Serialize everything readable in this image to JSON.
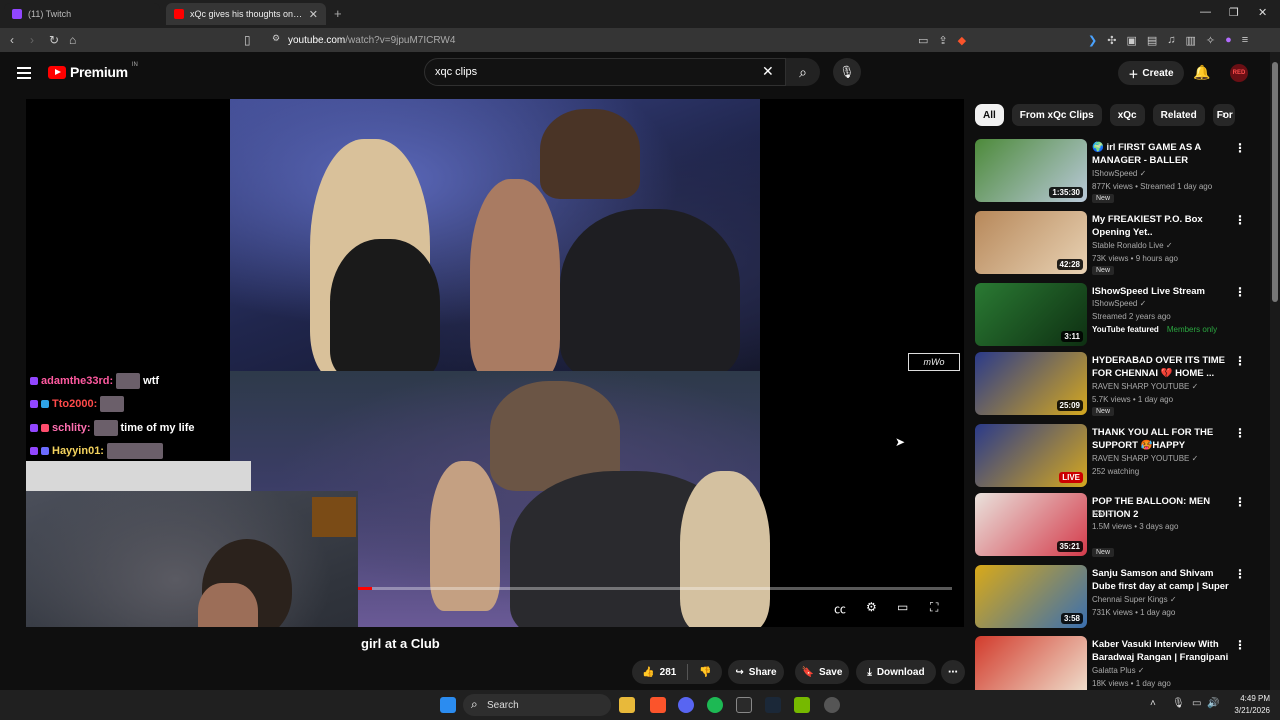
{
  "browser": {
    "tabs": [
      {
        "title": "(11) Twitch",
        "color": "#9146ff"
      },
      {
        "title": "xQc gives his thoughts on Cl…",
        "color": "#ff0000",
        "active": true
      }
    ],
    "url_host": "youtube.com",
    "url_path": "/watch?v=9jpuM7ICRW4"
  },
  "youtube": {
    "logo": "Premium",
    "logo_country": "IN",
    "search_value": "xqc clips",
    "create_label": "Create",
    "avatar_text": "RED"
  },
  "player": {
    "watermark": "mWo",
    "progress": 0.024,
    "chat": [
      {
        "user": "adamthe33rd:",
        "msg": "wtf",
        "color": "#ff5aa0"
      },
      {
        "user": "Tto2000:",
        "msg": "",
        "color": "#ff4a4a"
      },
      {
        "user": "schlity:",
        "msg": "time of my life",
        "color": "#ff6fb0"
      },
      {
        "user": "Hayyin01:",
        "msg": "",
        "color": "#f4d35e"
      }
    ]
  },
  "video": {
    "title": "girl at a Club",
    "likes": "281",
    "share": "Share",
    "save": "Save",
    "download": "Download"
  },
  "chips": [
    "All",
    "From xQc Clips",
    "xQc",
    "Related",
    "For"
  ],
  "recommendations": [
    {
      "title": "🌍 irl FIRST GAME AS A MANAGER - BALLER LEAGUE ...",
      "channel": "IShowSpeed ✓",
      "meta": "877K views • Streamed 1 day ago",
      "badge": "New",
      "duration": "1:35:30",
      "colors": [
        "#4d8a3a",
        "#b9c9d9"
      ]
    },
    {
      "title": "My FREAKIEST P.O. Box Opening Yet..",
      "channel": "Stable Ronaldo Live ✓",
      "meta": "73K views • 9 hours ago",
      "badge": "New",
      "duration": "42:28",
      "colors": [
        "#b7885a",
        "#e8d2b4"
      ]
    },
    {
      "title": "IShowSpeed Live Stream",
      "channel": "IShowSpeed ✓",
      "meta": "Streamed 2 years ago",
      "featured": "YouTube featured",
      "members": "Members only",
      "duration": "3:11",
      "colors": [
        "#2a7a33",
        "#0e2f12"
      ]
    },
    {
      "title": "HYDERABAD OVER ITS TIME FOR CHENNAI 💔 HOME ...",
      "channel": "RAVEN SHARP YOUTUBE ✓",
      "meta": "5.7K views • 1 day ago",
      "badge": "New",
      "duration": "25:09",
      "colors": [
        "#2a3a8a",
        "#d5a81f"
      ]
    },
    {
      "title": "THANK YOU ALL FOR THE SUPPORT 🥵HAPPY RAMZAN...",
      "channel": "RAVEN SHARP YOUTUBE ✓",
      "meta": "252 watching",
      "duration": "LIVE",
      "colors": [
        "#2a3a8a",
        "#d5a81f"
      ]
    },
    {
      "title": "POP THE BALLOON: MEN EDITION 2",
      "channel": "KSI ✓",
      "meta": "1.5M views • 3 days ago",
      "badge": "New",
      "duration": "35:21",
      "colors": [
        "#e9e2dc",
        "#d43b4b"
      ]
    },
    {
      "title": "Sanju Samson and Shivam Dube first day at camp | Super ...",
      "channel": "Chennai Super Kings ✓",
      "meta": "731K views • 1 day ago",
      "duration": "3:58",
      "colors": [
        "#d9a918",
        "#3a6fb0"
      ]
    },
    {
      "title": "Kaber Vasuki Interview With Baradwaj Rangan | Frangipani ...",
      "channel": "Galatta Plus ✓",
      "meta": "18K views • 1 day ago",
      "duration": "",
      "colors": [
        "#d23b2c",
        "#f0e4d2"
      ]
    }
  ],
  "taskbar": {
    "search": "Search",
    "time": "4:49 PM",
    "date": "3/21/2026"
  }
}
